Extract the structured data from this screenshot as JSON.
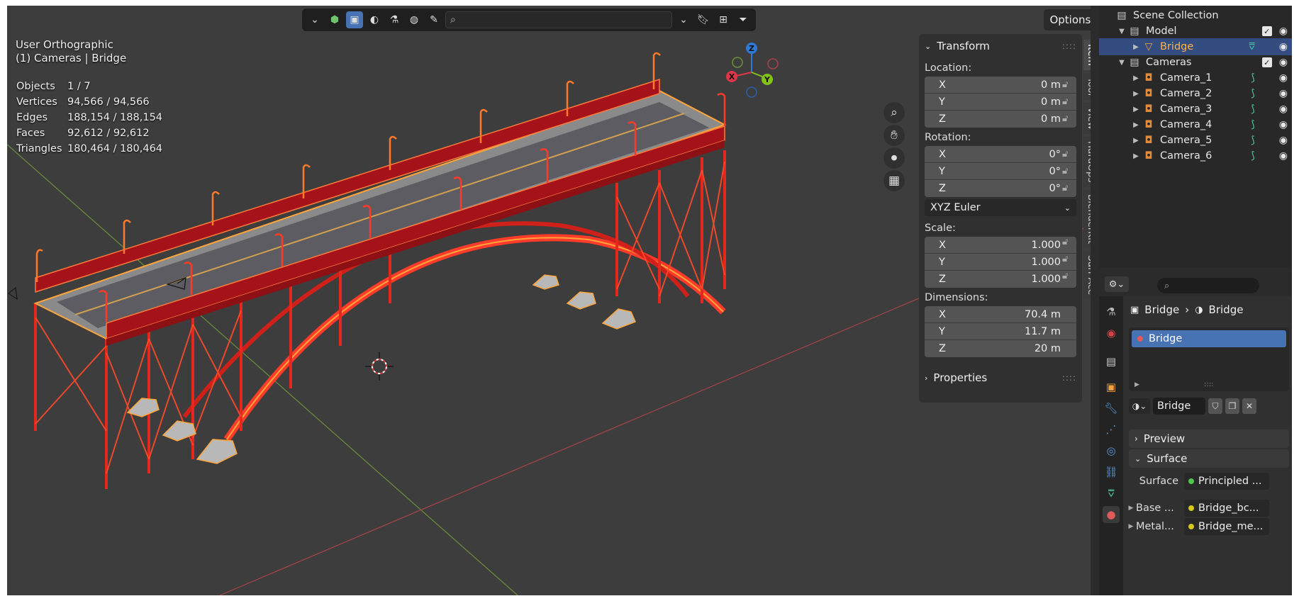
{
  "viewport": {
    "view_name": "User Orthographic",
    "view_context": "(1) Cameras | Bridge",
    "stats": [
      {
        "label": "Objects",
        "value": "1 / 7"
      },
      {
        "label": "Vertices",
        "value": "94,566 / 94,566"
      },
      {
        "label": "Edges",
        "value": "188,154 / 188,154"
      },
      {
        "label": "Faces",
        "value": "92,612 / 92,612"
      },
      {
        "label": "Triangles",
        "value": "180,464 / 180,464"
      }
    ],
    "options_label": "Options",
    "gizmo": {
      "x": "X",
      "y": "Y",
      "z": "Z",
      "colors": {
        "x": "#e0364a",
        "y": "#82c21a",
        "z": "#2f7ad6"
      }
    }
  },
  "npanel": {
    "transform_title": "Transform",
    "location_label": "Location:",
    "location": [
      {
        "axis": "X",
        "value": "0 m"
      },
      {
        "axis": "Y",
        "value": "0 m"
      },
      {
        "axis": "Z",
        "value": "0 m"
      }
    ],
    "rotation_label": "Rotation:",
    "rotation": [
      {
        "axis": "X",
        "value": "0°"
      },
      {
        "axis": "Y",
        "value": "0°"
      },
      {
        "axis": "Z",
        "value": "0°"
      }
    ],
    "rotation_mode": "XYZ Euler",
    "scale_label": "Scale:",
    "scale": [
      {
        "axis": "X",
        "value": "1.000"
      },
      {
        "axis": "Y",
        "value": "1.000"
      },
      {
        "axis": "Z",
        "value": "1.000"
      }
    ],
    "dimensions_label": "Dimensions:",
    "dimensions": [
      {
        "axis": "X",
        "value": "70.4 m"
      },
      {
        "axis": "Y",
        "value": "11.7 m"
      },
      {
        "axis": "Z",
        "value": "20 m"
      }
    ],
    "properties_title": "Properties",
    "tabs": [
      "Item",
      "Tool",
      "View",
      "HardOps",
      "BlenderKit",
      "Surf Ace"
    ]
  },
  "outliner": {
    "scene_collection": "Scene Collection",
    "model_collection": "Model",
    "bridge_object": "Bridge",
    "cameras_collection": "Cameras",
    "cameras": [
      "Camera_1",
      "Camera_2",
      "Camera_3",
      "Camera_4",
      "Camera_5",
      "Camera_6"
    ]
  },
  "properties": {
    "breadcrumb_object": "Bridge",
    "breadcrumb_material": "Bridge",
    "slot_name": "Bridge",
    "material_name": "Bridge",
    "preview_label": "Preview",
    "surface_section": "Surface",
    "surface_label": "Surface",
    "surface_value": "Principled ...",
    "base_label": "Base ...",
    "base_value": "Bridge_bc...",
    "metal_label": "Metal...",
    "metal_value": "Bridge_me..."
  },
  "colors": {
    "accent": "#4772b3",
    "selected_row": "#334d80",
    "bridge_red": "#e02020",
    "selection_outline": "#ffa53a"
  }
}
